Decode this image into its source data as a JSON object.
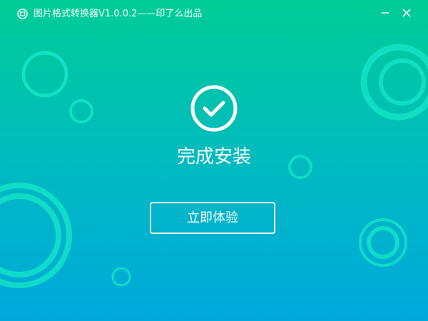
{
  "window": {
    "title": "图片格式转换器V1.0.0.2——印了么出品"
  },
  "icons": {
    "app": "refresh-image-icon",
    "minimize": "minimize-icon",
    "close": "close-icon",
    "status": "check-circle-icon"
  },
  "main": {
    "status_text": "完成安装",
    "action_label": "立即体验"
  },
  "colors": {
    "gradient_top": "#00cd96",
    "gradient_bottom": "#00a9dc",
    "ring": "#13e3c8",
    "text": "#ffffff"
  }
}
